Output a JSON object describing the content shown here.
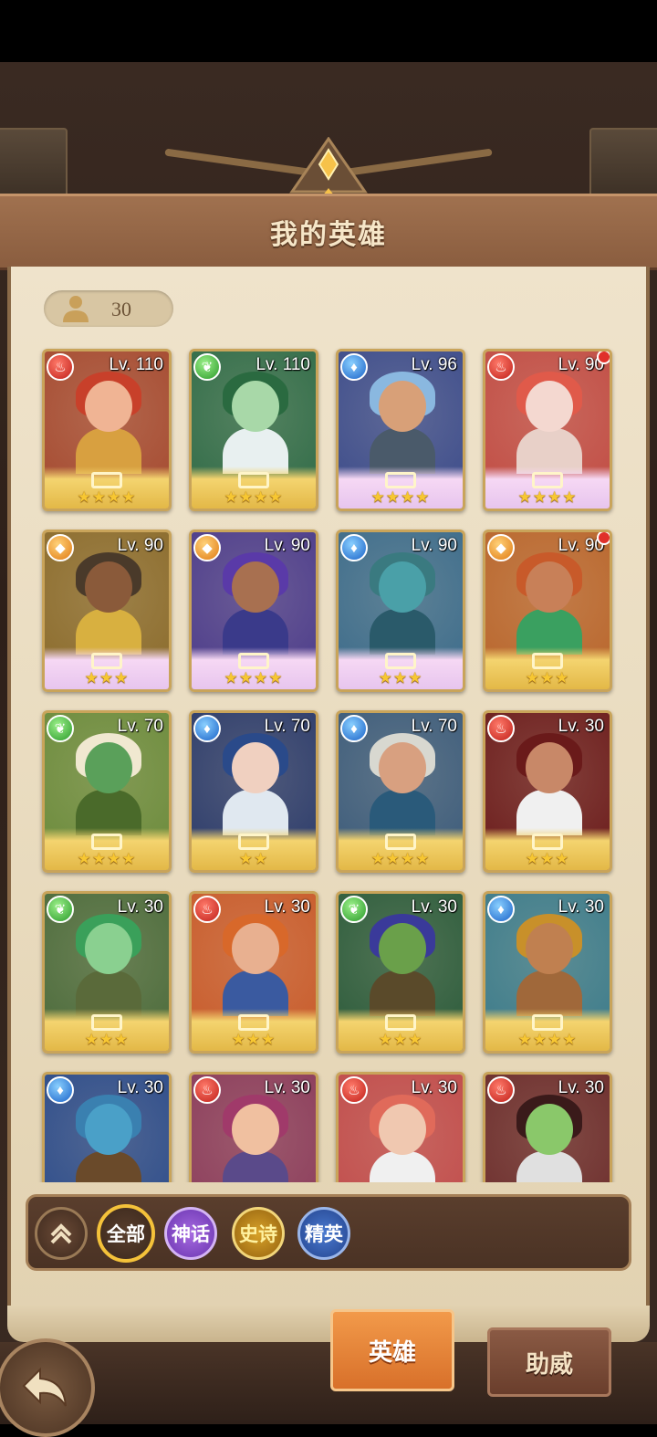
{
  "header": {
    "title": "我的英雄"
  },
  "hero_count": {
    "icon": "person-icon",
    "value": "30"
  },
  "heroes": [
    {
      "level": "Lv. 110",
      "element": "fire",
      "stars": "★★★★",
      "rarity": "legend",
      "notify": false,
      "skin": "#f0b494",
      "hair": "#c8402a",
      "bg": "#a4482e",
      "outfit": "#d8a040"
    },
    {
      "level": "Lv. 110",
      "element": "nature",
      "stars": "★★★★",
      "rarity": "legend",
      "notify": false,
      "skin": "#a8d8a8",
      "hair": "#2a6a40",
      "bg": "#2e6a46",
      "outfit": "#e8f0f0"
    },
    {
      "level": "Lv. 96",
      "element": "water",
      "stars": "★★★★",
      "rarity": "mythic",
      "notify": false,
      "skin": "#d8a078",
      "hair": "#8ab8e0",
      "bg": "#3a4a8a",
      "outfit": "#4a5a6a"
    },
    {
      "level": "Lv. 90",
      "element": "fire",
      "stars": "★★★★",
      "rarity": "mythic",
      "notify": true,
      "skin": "#f4d8d0",
      "hair": "#e05a4a",
      "bg": "#c04a42",
      "outfit": "#e8d0c8"
    },
    {
      "level": "Lv. 90",
      "element": "light",
      "stars": "★★★",
      "rarity": "mythic",
      "notify": false,
      "skin": "#8a5a3a",
      "hair": "#4a3a2a",
      "bg": "#8a6a2a",
      "outfit": "#d8b040"
    },
    {
      "level": "Lv. 90",
      "element": "light",
      "stars": "★★★★",
      "rarity": "mythic",
      "notify": false,
      "skin": "#a87050",
      "hair": "#5a3aa8",
      "bg": "#4a3a8a",
      "outfit": "#3a3a8a"
    },
    {
      "level": "Lv. 90",
      "element": "water",
      "stars": "★★★",
      "rarity": "mythic",
      "notify": false,
      "skin": "#4aa0a8",
      "hair": "#3a7a80",
      "bg": "#3a6a8a",
      "outfit": "#2a5a6a"
    },
    {
      "level": "Lv. 90",
      "element": "light",
      "stars": "★★★",
      "rarity": "legend",
      "notify": true,
      "skin": "#c88058",
      "hair": "#c85a2a",
      "bg": "#b8642a",
      "outfit": "#3aa060"
    },
    {
      "level": "Lv. 70",
      "element": "nature",
      "stars": "★★★★",
      "rarity": "legend",
      "notify": false,
      "skin": "#5aa05a",
      "hair": "#f0e8d0",
      "bg": "#6a8a3a",
      "outfit": "#4a6a2a"
    },
    {
      "level": "Lv. 70",
      "element": "water",
      "stars": "★★",
      "rarity": "legend",
      "notify": false,
      "skin": "#f0d0c0",
      "hair": "#2a4a8a",
      "bg": "#2a3a6a",
      "outfit": "#e0e8f0"
    },
    {
      "level": "Lv. 70",
      "element": "water",
      "stars": "★★★★",
      "rarity": "legend",
      "notify": false,
      "skin": "#d8a080",
      "hair": "#d8d8d0",
      "bg": "#3a5a7a",
      "outfit": "#2a5a7a"
    },
    {
      "level": "Lv. 30",
      "element": "fire",
      "stars": "★★★",
      "rarity": "legend",
      "notify": false,
      "skin": "#c88868",
      "hair": "#6a1a1a",
      "bg": "#6a1a1a",
      "outfit": "#f0f0f0"
    },
    {
      "level": "Lv. 30",
      "element": "nature",
      "stars": "★★★",
      "rarity": "legend",
      "notify": false,
      "skin": "#8ad090",
      "hair": "#3aa05a",
      "bg": "#4a6a3a",
      "outfit": "#5a6a3a"
    },
    {
      "level": "Lv. 30",
      "element": "fire",
      "stars": "★★★",
      "rarity": "legend",
      "notify": false,
      "skin": "#e8b090",
      "hair": "#d8682a",
      "bg": "#c85a2a",
      "outfit": "#3a5aa0"
    },
    {
      "level": "Lv. 30",
      "element": "nature",
      "stars": "★★★",
      "rarity": "legend",
      "notify": false,
      "skin": "#6aa04a",
      "hair": "#3a3a9a",
      "bg": "#2a5a3a",
      "outfit": "#5a4a2a"
    },
    {
      "level": "Lv. 30",
      "element": "water",
      "stars": "★★★★",
      "rarity": "legend",
      "notify": false,
      "skin": "#c08050",
      "hair": "#c8902a",
      "bg": "#3a7a8a",
      "outfit": "#a0683a"
    },
    {
      "level": "Lv. 30",
      "element": "water",
      "stars": "★★★",
      "rarity": "legend",
      "notify": false,
      "skin": "#4aa0c8",
      "hair": "#3a80b0",
      "bg": "#2a4a8a",
      "outfit": "#6a4a2a"
    },
    {
      "level": "Lv. 30",
      "element": "fire",
      "stars": "★★★",
      "rarity": "legend",
      "notify": false,
      "skin": "#f0c0a0",
      "hair": "#a03a6a",
      "bg": "#8a3a5a",
      "outfit": "#5a4a8a"
    },
    {
      "level": "Lv. 30",
      "element": "fire",
      "stars": "★★★",
      "rarity": "legend",
      "notify": false,
      "skin": "#f0c8b0",
      "hair": "#e06a5a",
      "bg": "#c04a4a",
      "outfit": "#f0f0f0"
    },
    {
      "level": "Lv. 30",
      "element": "fire",
      "stars": "★★★",
      "rarity": "legend",
      "notify": false,
      "skin": "#8ac86a",
      "hair": "#3a1a1a",
      "bg": "#6a2a2a",
      "outfit": "#e0e0e0"
    }
  ],
  "filters": {
    "collapse": "chevron-up-icon",
    "all": "全部",
    "myth": "神话",
    "epic": "史诗",
    "elite": "精英"
  },
  "tabs": {
    "heroes": "英雄",
    "support": "助威"
  },
  "back": {
    "icon": "back-arrow-icon"
  },
  "colors": {
    "header": "#8a5d3f",
    "parchment": "#efe3cb",
    "card_gold": "#c9a45a",
    "active_tab": "#f29a4a"
  }
}
